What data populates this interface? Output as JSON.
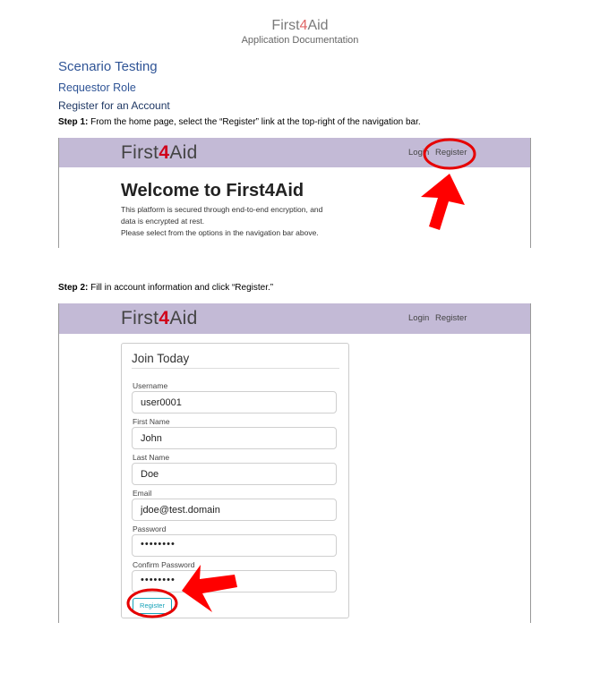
{
  "document": {
    "brand_prefix": "First",
    "brand_four": "4",
    "brand_suffix": "Aid",
    "subtitle": "Application Documentation"
  },
  "headings": {
    "h1": "Scenario Testing",
    "h2": "Requestor Role",
    "h3": "Register for an Account"
  },
  "steps": [
    {
      "label": "Step 1:",
      "text": " From the home page, select the “Register” link at the top-right of the navigation bar."
    },
    {
      "label": "Step 2:",
      "text": " Fill in account information and click “Register.”"
    }
  ],
  "app": {
    "brand_prefix": "First",
    "brand_four": "4",
    "brand_suffix": "Aid",
    "nav_login": "Login",
    "nav_register": "Register",
    "navbar_color": "#c3bad6",
    "accent_red": "#d0021b"
  },
  "screenshot1": {
    "welcome": "Welcome to First4Aid",
    "lines": [
      "This platform is secured through end-to-end encryption, and",
      "data is encrypted at rest.",
      "Please select from the options in the navigation bar above."
    ]
  },
  "screenshot2": {
    "form_title": "Join Today",
    "fields": [
      {
        "label": "Username",
        "value": "user0001"
      },
      {
        "label": "First Name",
        "value": "John"
      },
      {
        "label": "Last Name",
        "value": "Doe"
      },
      {
        "label": "Email",
        "value": "jdoe@test.domain"
      },
      {
        "label": "Password",
        "value": "••••••••"
      },
      {
        "label": "Confirm Password",
        "value": "••••••••"
      }
    ],
    "submit_label": "Register"
  }
}
